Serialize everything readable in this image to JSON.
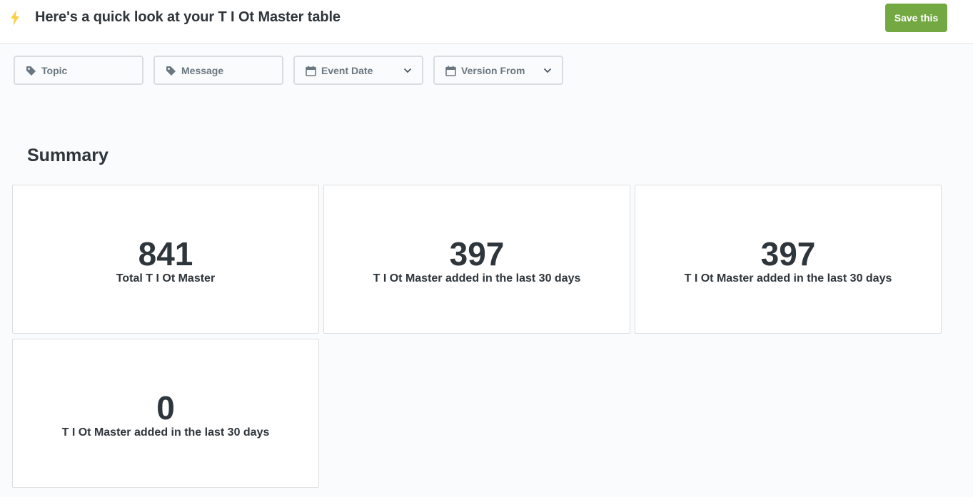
{
  "header": {
    "title": "Here's a quick look at your T I Ot Master table",
    "save_label": "Save this",
    "bolt_icon": "lightning-bolt-icon",
    "bolt_color": "#f9cf48",
    "save_color": "#74a843"
  },
  "filters": [
    {
      "label": "Topic",
      "icon": "tag-icon"
    },
    {
      "label": "Message",
      "icon": "tag-icon"
    },
    {
      "label": "Event Date",
      "icon": "calendar-icon",
      "dropdown": true
    },
    {
      "label": "Version From",
      "icon": "calendar-icon",
      "dropdown": true
    }
  ],
  "summary": {
    "title": "Summary",
    "cards": [
      {
        "value": "841",
        "label": "Total T I Ot Master"
      },
      {
        "value": "397",
        "label": "T I Ot Master added in the last 30 days"
      },
      {
        "value": "397",
        "label": "T I Ot Master added in the last 30 days"
      },
      {
        "value": "0",
        "label": "T I Ot Master added in the last 30 days"
      }
    ]
  }
}
